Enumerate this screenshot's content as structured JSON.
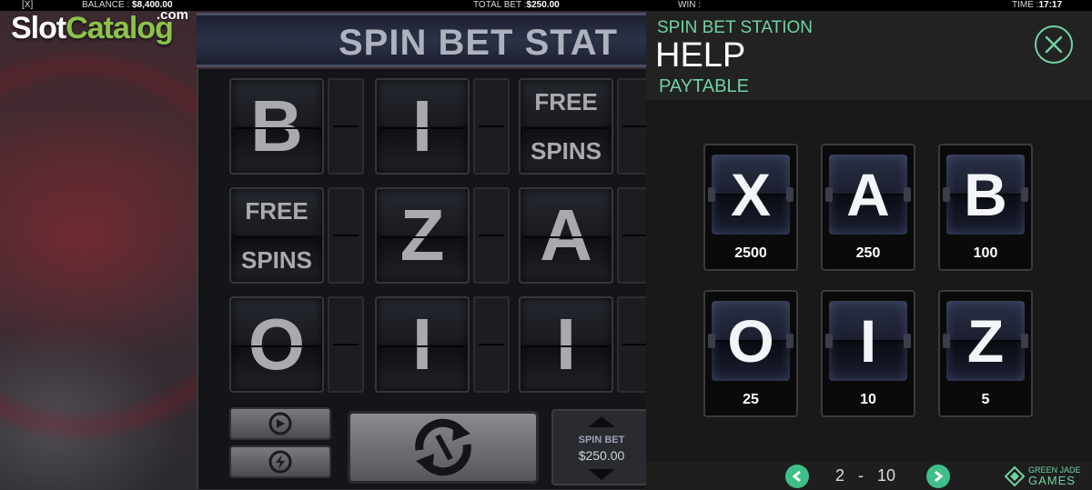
{
  "topbar": {
    "close": "[X]",
    "balance_label": "BALANCE :",
    "balance_value": "$8,400.00",
    "total_bet_label": "TOTAL BET :",
    "total_bet_value": "$250.00",
    "win_label": "WIN :",
    "time_label": "TIME :",
    "time_value": "17:17"
  },
  "watermark": {
    "slot": "Slot",
    "catalog": "Catalog",
    "com": ".com"
  },
  "game": {
    "title": "SPIN BET STAT",
    "reels": [
      [
        "B",
        "I",
        "FREE|SPINS"
      ],
      [
        "FREE|SPINS",
        "Z",
        "A"
      ],
      [
        "O",
        "I",
        "I"
      ]
    ],
    "bet_label": "SPIN BET",
    "bet_value": "$250.00"
  },
  "help": {
    "game_name": "SPIN BET STATION",
    "title": "HELP",
    "section": "PAYTABLE",
    "paytable": [
      {
        "symbol": "X",
        "payout": "2500"
      },
      {
        "symbol": "A",
        "payout": "250"
      },
      {
        "symbol": "B",
        "payout": "100"
      },
      {
        "symbol": "O",
        "payout": "25"
      },
      {
        "symbol": "I",
        "payout": "10"
      },
      {
        "symbol": "Z",
        "payout": "5"
      }
    ],
    "page_current": "2",
    "page_sep": "-",
    "page_total": "10",
    "brand_top": "GREEN JADE",
    "brand_bottom": "GAMES"
  },
  "colors": {
    "accent": "#6fd3a0",
    "nav_button": "#3fbf88",
    "watermark_green": "#8bc34a"
  }
}
